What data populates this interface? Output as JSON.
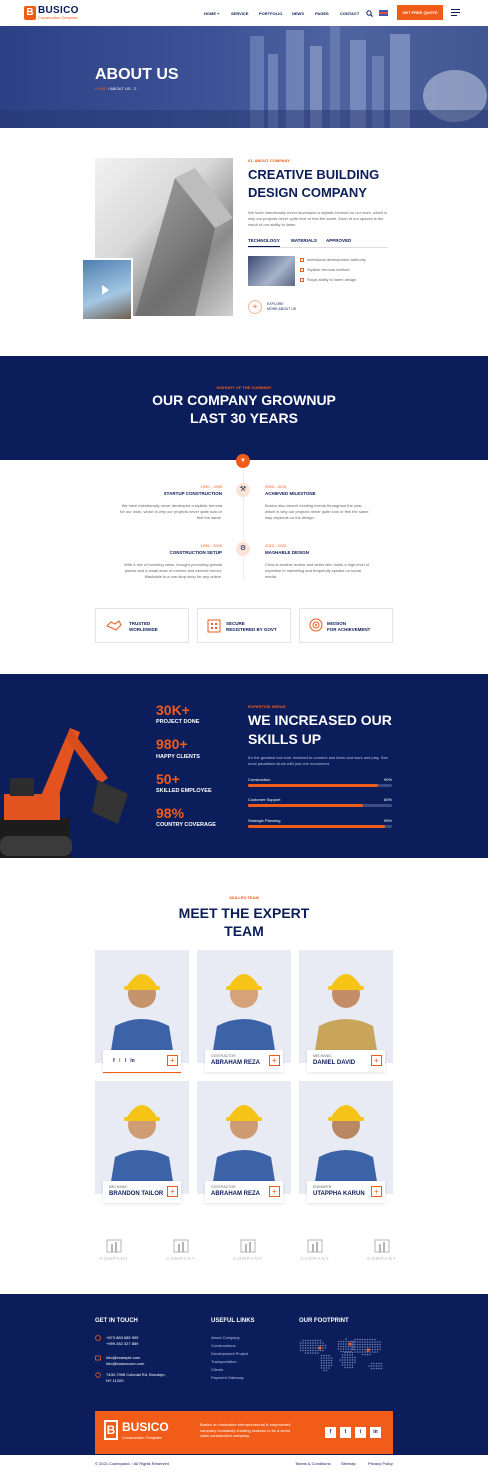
{
  "header": {
    "logo_letter": "B",
    "logo_name": "BUSICO",
    "logo_tagline": "Construction Template",
    "nav": [
      "HOME +",
      "SERVICE",
      "PORTFOLIO",
      "NEWS",
      "PAGES",
      "CONTACT"
    ],
    "quote_button": "GET FREE QUOTE",
    "icons": [
      "search-icon",
      "flag-icon",
      "menu-icon"
    ]
  },
  "hero": {
    "title": "ABOUT US",
    "crumb_home": "HOME",
    "crumb_sep": "/",
    "crumb_current": "ABOUT US - 2"
  },
  "about": {
    "label": "01. ABOUT COMPANY",
    "title_line1": "CREATIVE BUILDING",
    "title_line2": "DESIGN COMPANY",
    "text": "We have intentionally never developed a stylistic formula for our work, which is why our projects never quite look or feel the same. Each of our spaces is the result of our ability to listen.",
    "tabs": [
      "TECHNOLOGY",
      "MATERIALS",
      "APPROVED"
    ],
    "checks": [
      "Intentional development authority",
      "Stylistic formula method",
      "Royal ability to listen design"
    ],
    "explore_line1": "EXPLORE",
    "explore_line2": "MORE ABOUT US"
  },
  "growth": {
    "label": "HISHORY OF THE COMPANY",
    "title_line1": "OUR COMPANY GROWNUP",
    "title_line2": "LAST 30 YEARS"
  },
  "timeline": [
    {
      "year": "1990 - 1995",
      "title": "STARTUP CONSTRUCTION",
      "text": "We have intentionally never developed a stylistic formula for our work, which is why our projects never quite look or feel the same."
    },
    {
      "year": "2005 - 2015",
      "title": "ACHIEVED MILESTONE",
      "text": "Busico also launch exciting events throughout the year, which is why our projects never quite look or feel the same way depends on the design."
    },
    {
      "year": "1995 - 2005",
      "title": "CONSTRUCTION SETUP",
      "text": "With a mix of booming news, thought-provoking special pieces and a small dose of memes and internet humor, Mashable is a one-stop shop for any online."
    },
    {
      "year": "2015 - 2020",
      "title": "MASHABLE DESIGN",
      "text": "Chris is another author and writer who holds a high level of expertise in marketing and frequently speaks on social media."
    }
  ],
  "features": [
    {
      "line1": "TRUSTED",
      "line2": "WORLDWIDE",
      "icon": "handshake-icon"
    },
    {
      "line1": "SECURE",
      "line2": "REGISTERED BY GOVT",
      "icon": "building-icon"
    },
    {
      "line1": "MISSION",
      "line2": "FOR ACHIEVEMENT",
      "icon": "target-icon"
    }
  ],
  "stats": [
    {
      "num": "30K+",
      "label": "PROJECT DONE"
    },
    {
      "num": "980+",
      "label": "HAPPY CLIENTS"
    },
    {
      "num": "50+",
      "label": "SKILLED EMPLOYEE"
    },
    {
      "num": "98%",
      "label": "COUNTRY COVERAGE"
    }
  ],
  "skills": {
    "label": "EXPERTISE AREAS",
    "title_line1": "WE INCREASED OUR",
    "title_line2": "SKILLS UP",
    "text": "It's the greatest tool ever invented to connect and learn and work and play. See most paradises stuck with just one monument.",
    "bars": [
      {
        "name": "Construction",
        "value": "90%",
        "fraction": 0.9
      },
      {
        "name": "Customer Support",
        "value": "80%",
        "fraction": 0.8
      },
      {
        "name": "Strategic Planning",
        "value": "95%",
        "fraction": 0.95
      }
    ]
  },
  "team": {
    "label": "SKILLED TEAM",
    "title_line1": "MEET THE EXPERT",
    "title_line2": "TEAM",
    "members": [
      {
        "role": "",
        "name": ""
      },
      {
        "role": "CONTRACTOR",
        "name": "ABRAHAM REZA"
      },
      {
        "role": "MECHANIC",
        "name": "DANIEL DAVID"
      },
      {
        "role": "MECHANIC",
        "name": "BRANDON TAILOR"
      },
      {
        "role": "CONTRACTOR",
        "name": "ABRAHAM REZA"
      },
      {
        "role": "ENGINEER",
        "name": "UTAPPHA KARUN"
      }
    ],
    "social": [
      "f",
      "t",
      "i",
      "in"
    ],
    "plus": "+"
  },
  "partners": [
    "COMPANY",
    "COMPANY",
    "COMPANY",
    "COMPANY",
    "COMPANY"
  ],
  "footer": {
    "touch_title": "GET IN TOUCH",
    "phone1": "+673 883 685 999",
    "phone2": "+999 282 327 889",
    "email1": "info@example.com",
    "email2": "info@busicocom.com",
    "addr1": "7400-7998 Colonial Rd, Brooklyn,",
    "addr2": "NY 11209",
    "links_title": "USEFUL LINKS",
    "links": [
      "About Company",
      "Constructions",
      "Development Project",
      "Transportation",
      "Clients",
      "Payment Gateway"
    ],
    "footprint_title": "OUR FOOTPRINT",
    "band_logo_letter": "B",
    "band_logo_name": "BUSICO",
    "band_logo_tag": "Construction Template",
    "band_text": "Busico an innovative entrepreneurial & empowered company constantly creating reasons to be a world class construction company.",
    "band_social": [
      "f",
      "t",
      "i",
      "in"
    ],
    "copyright": "© 2021 Codexpand. / All Rights Reserved",
    "bottom_links": [
      "Teams & Conditions",
      "Sitemap",
      "Privacy Policy"
    ]
  }
}
